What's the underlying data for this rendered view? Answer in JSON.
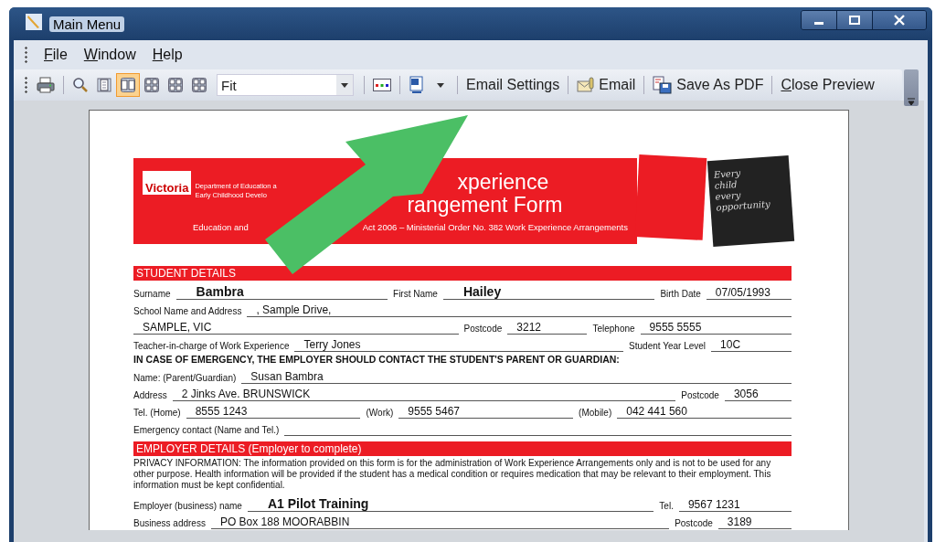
{
  "window": {
    "title": "Main Menu"
  },
  "menu": [
    "File",
    "Window",
    "Help"
  ],
  "toolbar": {
    "view_buttons": [
      {
        "selected": false
      },
      {
        "selected": true
      },
      {
        "selected": false
      },
      {
        "selected": false
      },
      {
        "selected": false
      }
    ],
    "zoom": "Fit",
    "buttons": [
      "Email Settings",
      "Email",
      "Save As PDF",
      "Close Preview"
    ]
  },
  "form": {
    "header": {
      "logo": "Victoria",
      "dept": [
        "Department of Education a",
        "Early Childhood Develo"
      ],
      "title": [
        "xperience",
        "rangement Form"
      ],
      "subtitle": [
        "Education and",
        "Act 2006 – Ministerial Order No. 382 Work Experience Arrangements"
      ],
      "slogan": [
        "Every",
        "child",
        "every",
        "opportunity"
      ]
    },
    "sections": [
      {
        "title": "STUDENT DETAILS",
        "rows": [
          {
            "kind": "fields",
            "cells": [
              {
                "label": "Surname",
                "value": "Bambra",
                "large": true
              },
              {
                "label": "First Name",
                "value": "Hailey",
                "large": true
              },
              {
                "label": "Birth Date",
                "value": "07/05/1993",
                "large": false
              }
            ]
          },
          {
            "kind": "fields",
            "cells": [
              {
                "label": "School Name and Address",
                "value": ", Sample Drive,",
                "large": false
              }
            ]
          },
          {
            "kind": "fields",
            "cells": [
              {
                "value": "SAMPLE, VIC",
                "large": false
              },
              {
                "label": "Postcode",
                "value": "3212",
                "large": false
              },
              {
                "label": "Telephone",
                "value": "9555 5555",
                "large": false
              }
            ]
          },
          {
            "kind": "fields",
            "cells": [
              {
                "label": "Teacher-in-charge of Work Experience",
                "value": "Terry Jones",
                "large": false
              },
              {
                "label": "Student Year Level",
                "value": "10C",
                "large": false
              }
            ]
          },
          {
            "kind": "heading",
            "text": "IN CASE OF EMERGENCY, THE EMPLOYER SHOULD CONTACT THE STUDENT'S PARENT OR GUARDIAN:"
          },
          {
            "kind": "fields",
            "cells": [
              {
                "label": "Name: (Parent/Guardian)",
                "value": "Susan Bambra",
                "large": false
              }
            ]
          },
          {
            "kind": "fields",
            "cells": [
              {
                "label": "Address",
                "value": "2 Jinks Ave.  BRUNSWICK",
                "large": false
              },
              {
                "label": "Postcode",
                "value": "3056",
                "large": false
              }
            ]
          },
          {
            "kind": "fields",
            "cells": [
              {
                "label": "Tel. (Home)",
                "value": "8555 1243",
                "large": false
              },
              {
                "label": "(Work)",
                "value": "9555 5467",
                "large": false
              },
              {
                "label": "(Mobile)",
                "value": "042 441 560",
                "large": false
              }
            ]
          },
          {
            "kind": "fields",
            "cells": [
              {
                "label": "Emergency contact (Name and Tel.)"
              }
            ]
          }
        ]
      },
      {
        "title": "EMPLOYER DETAILS (Employer to complete)",
        "rows": [
          {
            "kind": "note",
            "text": "PRIVACY INFORMATION: The information provided on this form is for the administration of Work Experience Arrangements only and is not to be used for any other purpose. Health information will be provided if the student has a medical condition or requires medication that may be relevant to their employment. This information must be kept confidential."
          },
          {
            "kind": "fields",
            "cells": [
              {
                "label": "Employer (business) name",
                "value": "A1 Pilot Training",
                "large": true
              },
              {
                "label": "Tel.",
                "value": "9567 1231",
                "large": false
              }
            ]
          },
          {
            "kind": "fields",
            "cells": [
              {
                "label": "Business address",
                "value": "PO Box 188 MOORABBIN",
                "large": false
              },
              {
                "label": "Postcode",
                "value": "3189",
                "large": false
              }
            ]
          }
        ]
      }
    ]
  }
}
